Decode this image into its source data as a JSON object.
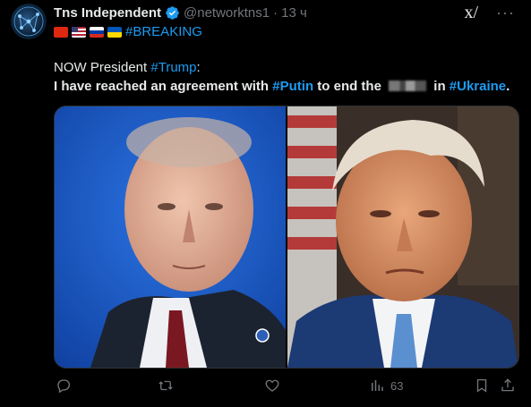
{
  "post": {
    "author_name": "Tns Independent",
    "handle": "@networktns1",
    "separator": "·",
    "time": "13 ч",
    "hashtag_breaking": "#BREAKING",
    "line1_prefix": "NOW President ",
    "line1_tag": "#Trump",
    "line1_suffix": ":",
    "line2_a": "I have reached an agreement with ",
    "line2_putin": "#Putin",
    "line2_b": " to end the ",
    "line2_c": " in ",
    "line2_ukraine": "#Ukraine",
    "line2_end": "."
  },
  "icons": {
    "verified": "verified-badge-icon",
    "grok": "grok-icon",
    "more": "more-icon",
    "reply": "reply-icon",
    "repost": "repost-icon",
    "like": "like-icon",
    "views": "views-icon",
    "bookmark": "bookmark-icon",
    "share": "share-icon"
  },
  "top_right": {
    "grok_glyph": "x/",
    "more_glyph": "···"
  },
  "actions": {
    "views_count": "63"
  },
  "colors": {
    "accent": "#1d9bf0",
    "muted": "#71767b",
    "background": "#000000"
  }
}
